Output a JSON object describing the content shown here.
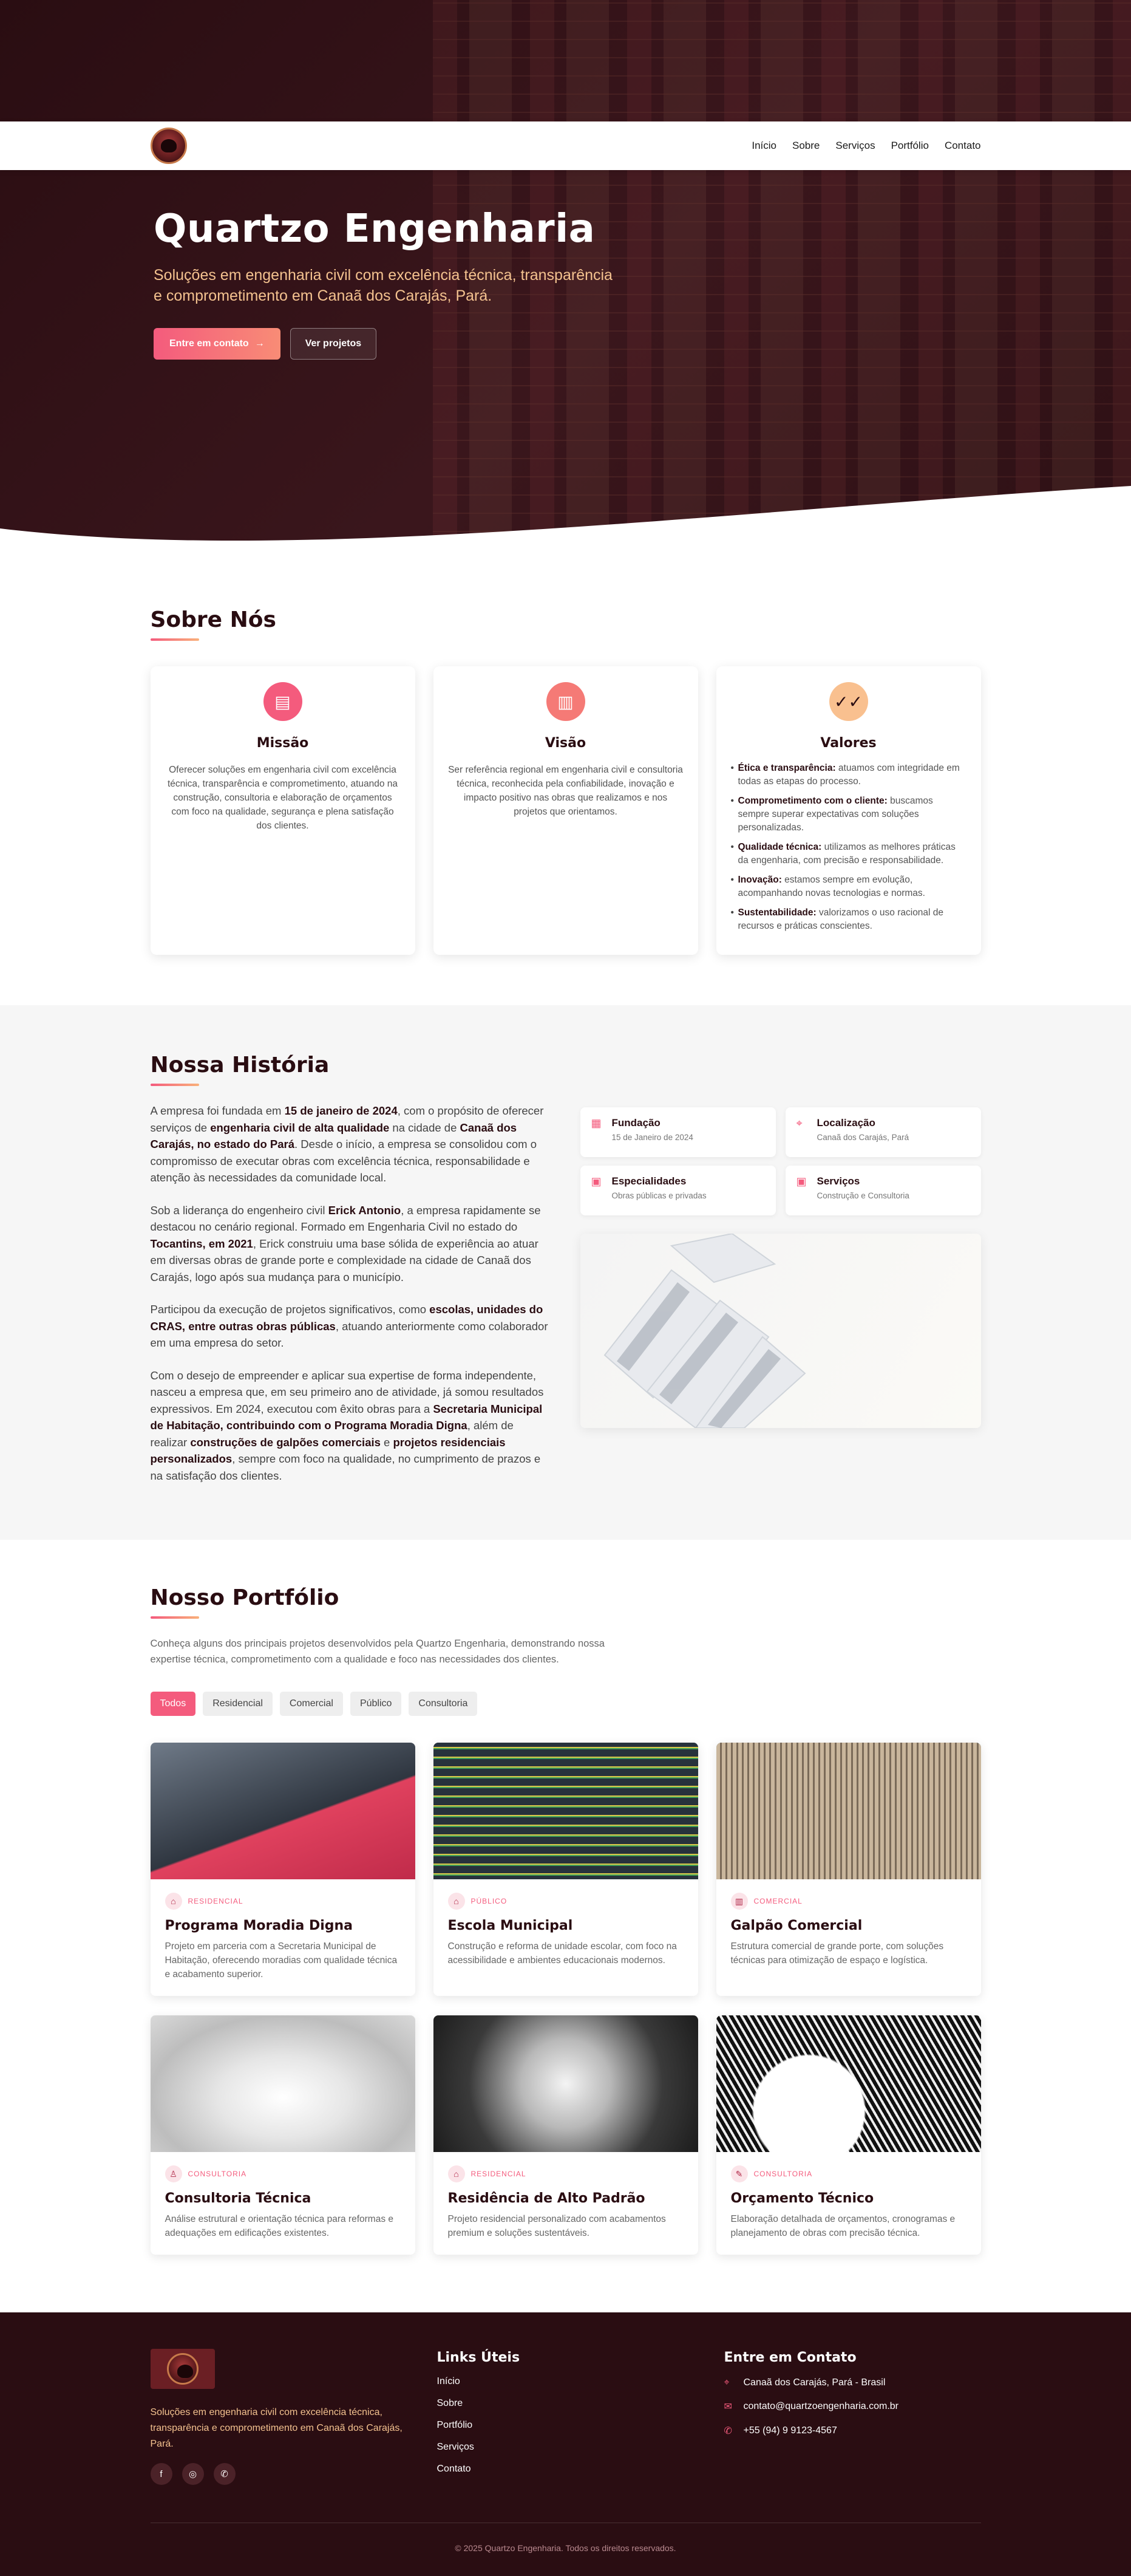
{
  "nav": {
    "links": [
      "Início",
      "Sobre",
      "Serviços",
      "Portfólio",
      "Contato"
    ]
  },
  "hero": {
    "title": "Quartzo Engenharia",
    "subtitle": "Soluções em engenharia civil com excelência técnica, transparência e comprometimento em Canaã dos Carajás, Pará.",
    "cta_primary": "Entre em contato",
    "cta_secondary": "Ver projetos"
  },
  "sobre": {
    "title": "Sobre Nós",
    "missao": {
      "title": "Missão",
      "text": "Oferecer soluções em engenharia civil com excelência técnica, transparência e comprometimento, atuando na construção, consultoria e elaboração de orçamentos com foco na qualidade, segurança e plena satisfação dos clientes."
    },
    "visao": {
      "title": "Visão",
      "text": "Ser referência regional em engenharia civil e consultoria técnica, reconhecida pela confiabilidade, inovação e impacto positivo nas obras que realizamos e nos projetos que orientamos."
    },
    "valores": {
      "title": "Valores",
      "items": [
        {
          "label": "Ética e transparência:",
          "text": " atuamos com integridade em todas as etapas do processo."
        },
        {
          "label": "Comprometimento com o cliente:",
          "text": " buscamos sempre superar expectativas com soluções personalizadas."
        },
        {
          "label": "Qualidade técnica:",
          "text": " utilizamos as melhores práticas da engenharia, com precisão e responsabilidade."
        },
        {
          "label": "Inovação:",
          "text": " estamos sempre em evolução, acompanhando novas tecnologias e normas."
        },
        {
          "label": "Sustentabilidade:",
          "text": " valorizamos o uso racional de recursos e práticas conscientes."
        }
      ]
    }
  },
  "historia": {
    "title": "Nossa História",
    "p1": [
      "A empresa foi fundada em ",
      "15 de janeiro de 2024",
      ", com o propósito de oferecer serviços de ",
      "engenharia civil de alta qualidade",
      " na cidade de ",
      "Canaã dos Carajás, no estado do Pará",
      ". Desde o início, a empresa se consolidou com o compromisso de executar obras com excelência técnica, responsabilidade e atenção às necessidades da comunidade local."
    ],
    "p2": [
      "Sob a liderança do engenheiro civil ",
      "Erick Antonio",
      ", a empresa rapidamente se destacou no cenário regional. Formado em Engenharia Civil no estado do ",
      "Tocantins, em 2021",
      ", Erick construiu uma base sólida de experiência ao atuar em diversas obras de grande porte e complexidade na cidade de Canaã dos Carajás, logo após sua mudança para o município."
    ],
    "p3": [
      "Participou da execução de projetos significativos, como ",
      "escolas, unidades do CRAS, entre outras obras públicas",
      ", atuando anteriormente como colaborador em uma empresa do setor."
    ],
    "p4": [
      "Com o desejo de empreender e aplicar sua expertise de forma independente, nasceu a empresa que, em seu primeiro ano de atividade, já somou resultados expressivos. Em 2024, executou com êxito obras para a ",
      "Secretaria Municipal de Habitação, contribuindo com o Programa Moradia Digna",
      ", além de realizar ",
      "construções de galpões comerciais",
      " e ",
      "projetos residenciais personalizados",
      ", sempre com foco na qualidade, no cumprimento de prazos e na satisfação dos clientes."
    ],
    "info": [
      {
        "icon": "calendar-icon",
        "title": "Fundação",
        "sub": "15 de Janeiro de 2024"
      },
      {
        "icon": "location-icon",
        "title": "Localização",
        "sub": "Canaã dos Carajás, Pará"
      },
      {
        "icon": "briefcase-icon",
        "title": "Especialidades",
        "sub": "Obras públicas e privadas"
      },
      {
        "icon": "briefcase-icon",
        "title": "Serviços",
        "sub": "Construção e Consultoria"
      }
    ]
  },
  "portfolio": {
    "title": "Nosso Portfólio",
    "description": "Conheça alguns dos principais projetos desenvolvidos pela Quartzo Engenharia, demonstrando nossa expertise técnica, comprometimento com a qualidade e foco nas necessidades dos clientes.",
    "filters": [
      "Todos",
      "Residencial",
      "Comercial",
      "Público",
      "Consultoria"
    ],
    "active_filter": "Todos",
    "projects": [
      {
        "tag": "RESIDENCIAL",
        "icon": "home-icon",
        "title": "Programa Moradia Digna",
        "text": "Projeto em parceria com a Secretaria Municipal de Habitação, oferecendo moradias com qualidade técnica e acabamento superior."
      },
      {
        "tag": "PÚBLICO",
        "icon": "home-icon",
        "title": "Escola Municipal",
        "text": "Construção e reforma de unidade escolar, com foco na acessibilidade e ambientes educacionais modernos."
      },
      {
        "tag": "COMERCIAL",
        "icon": "building-icon",
        "title": "Galpão Comercial",
        "text": "Estrutura comercial de grande porte, com soluções técnicas para otimização de espaço e logística."
      },
      {
        "tag": "CONSULTORIA",
        "icon": "person-icon",
        "title": "Consultoria Técnica",
        "text": "Análise estrutural e orientação técnica para reformas e adequações em edificações existentes."
      },
      {
        "tag": "RESIDENCIAL",
        "icon": "home-icon",
        "title": "Residência de Alto Padrão",
        "text": "Projeto residencial personalizado com acabamentos premium e soluções sustentáveis."
      },
      {
        "tag": "CONSULTORIA",
        "icon": "pencil-icon",
        "title": "Orçamento Técnico",
        "text": "Elaboração detalhada de orçamentos, cronogramas e planejamento de obras com precisão técnica."
      }
    ]
  },
  "footer": {
    "description": "Soluções em engenharia civil com excelência técnica, transparência e comprometimento em Canaã dos Carajás, Pará.",
    "links_title": "Links Úteis",
    "links": [
      "Início",
      "Sobre",
      "Portfólio",
      "Serviços",
      "Contato"
    ],
    "contact_title": "Entre em Contato",
    "address": "Canaã dos Carajás, Pará - Brasil",
    "email": "contato@quartzoengenharia.com.br",
    "phone": "+55 (94) 9 9123-4567",
    "copyright": "© 2025 Quartzo Engenharia. Todos os direitos reservados.",
    "socials": [
      "facebook-icon",
      "instagram-icon",
      "whatsapp-icon"
    ]
  },
  "colors": {
    "primary": "#f45b7d",
    "dark": "#2a0d12",
    "accent": "#f4c28f"
  }
}
